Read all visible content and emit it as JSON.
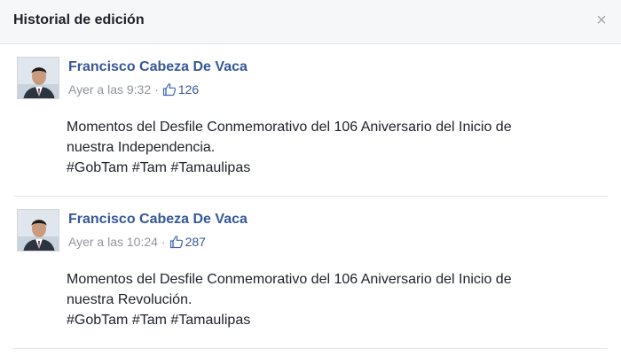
{
  "dialog": {
    "title": "Historial de edición",
    "close_symbol": "×"
  },
  "posts": [
    {
      "author": "Francisco Cabeza De Vaca",
      "timestamp": "Ayer a las 9:32",
      "separator": "·",
      "likes": "126",
      "lines": [
        "Momentos del Desfile Conmemorativo del 106 Aniversario del Inicio de",
        "nuestra Independencia.",
        "#GobTam #Tam #Tamaulipas"
      ]
    },
    {
      "author": "Francisco Cabeza De Vaca",
      "timestamp": "Ayer a las 10:24",
      "separator": "·",
      "likes": "287",
      "lines": [
        "Momentos del Desfile Conmemorativo del 106 Aniversario del Inicio de",
        "nuestra Revolución.",
        "#GobTam #Tam #Tamaulipas"
      ]
    }
  ],
  "icons": {
    "close": "close-icon",
    "like": "thumbs-up-icon",
    "avatar": "profile-photo"
  },
  "colors": {
    "author_link": "#365899",
    "meta_text": "#90949c",
    "header_bg": "#f6f7f9",
    "body_text": "#1d2129"
  }
}
